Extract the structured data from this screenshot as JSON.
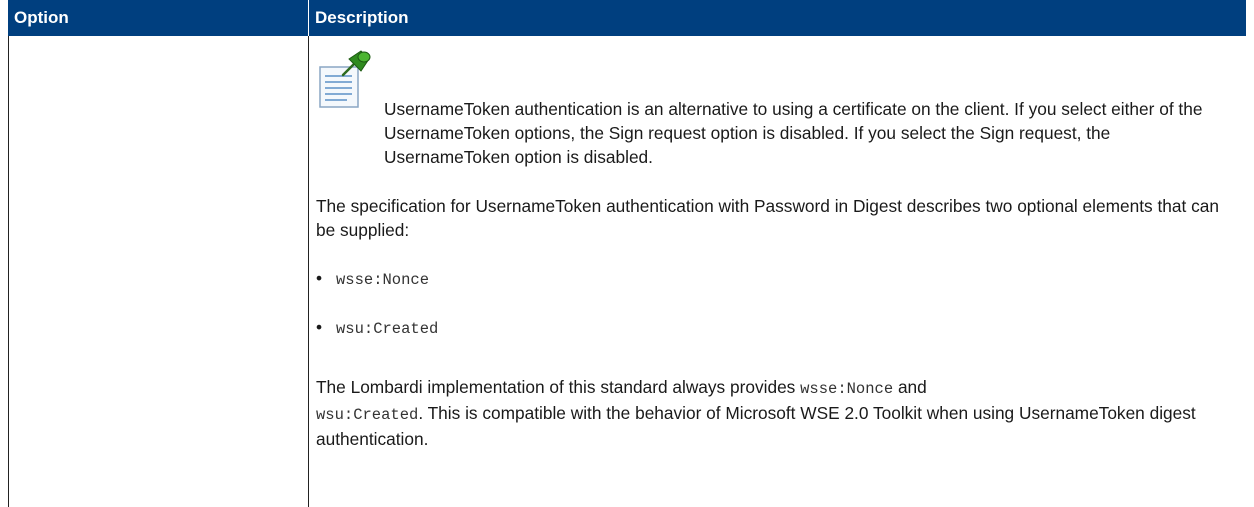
{
  "table": {
    "headers": {
      "option": "Option",
      "description": "Description"
    },
    "row": {
      "option": "",
      "note": {
        "icon": "pushpin-note-icon",
        "text": "UsernameToken authentication is an alternative to using a certificate on the client. If you select either of the UsernameToken options, the Sign request option is disabled. If you select the Sign request, the UsernameToken option is disabled."
      },
      "paragraph1": "The specification for UsernameToken authentication with Password in Digest describes two optional elements that can be supplied:",
      "bullets": [
        "wsse:Nonce",
        "wsu:Created"
      ],
      "paragraph2": {
        "part1": "The Lombardi implementation of this standard always provides ",
        "code1": "wsse:Nonce",
        "part2": " and ",
        "code2": "wsu:Created",
        "part3": ". This is compatible with the behavior of Microsoft WSE 2.0 Toolkit when using UsernameToken digest authentication."
      }
    }
  },
  "colors": {
    "header_bg": "#003f7f",
    "header_text": "#ffffff",
    "border": "#222222"
  }
}
